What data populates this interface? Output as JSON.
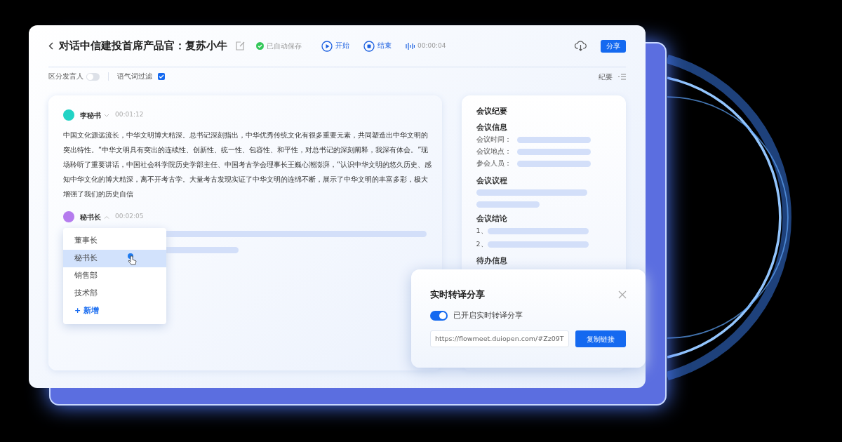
{
  "header": {
    "title": "对话中信建投首席产品官：复苏小牛",
    "autosave": "已自动保存",
    "start": "开始",
    "stop": "结束",
    "timer": "00:00:04",
    "share": "分享"
  },
  "toolbar": {
    "speaker_toggle": {
      "label": "区分发言人",
      "on": false
    },
    "filler_filter": {
      "label": "语气词过滤",
      "checked": true
    },
    "minutes": "纪要"
  },
  "transcript": [
    {
      "speaker": "李秘书",
      "color": "#22d3c5",
      "time": "00:01:12",
      "expanded": false,
      "text": "中国文化源远流长，中华文明博大精深。总书记深刻指出，中华优秀传统文化有很多重要元素，共同塑造出中华文明的突出特性。“中华文明具有突出的连续性、创新性、统一性、包容性、和平性，对总书记的深刻阐释，我深有体会。”现场聆听了重要讲话，中国社会科学院历史学部主任、中国考古学会理事长王巍心潮澎湃，“认识中华文明的悠久历史、感知中华文化的博大精深，离不开考古学。大量考古发现实证了中华文明的连绵不断，展示了中华文明的丰富多彩，极大增强了我们的历史自信"
    },
    {
      "speaker": "秘书长",
      "color": "#b57bee",
      "time": "00:02:05",
      "expanded": true
    }
  ],
  "speaker_menu": {
    "items": [
      {
        "label": "董事长",
        "selected": false
      },
      {
        "label": "秘书长",
        "selected": true
      },
      {
        "label": "销售部",
        "selected": false
      },
      {
        "label": "技术部",
        "selected": false
      }
    ],
    "add": "+ 新增"
  },
  "summary": {
    "title": "会议纪要",
    "sections": [
      {
        "kind": "fields",
        "heading": "会议信息",
        "labels": [
          "会议时间：",
          "会议地点：",
          "参会人员："
        ]
      },
      {
        "kind": "lines",
        "heading": "会议议程"
      },
      {
        "kind": "numbered",
        "heading": "会议结论",
        "labels": [
          "1、",
          "2、"
        ]
      },
      {
        "kind": "heading",
        "heading": "待办信息"
      }
    ]
  },
  "share_popup": {
    "title": "实时转译分享",
    "switch": {
      "label": "已开启实时转译分享",
      "on": true
    },
    "url": "https://flowmeet.duiopen.com/#Zz09T",
    "copy": "复制链接"
  }
}
